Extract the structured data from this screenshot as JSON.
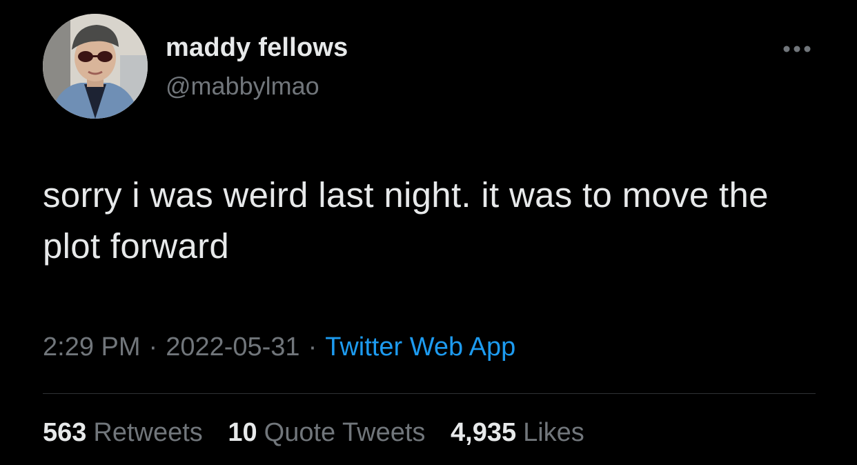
{
  "tweet": {
    "author": {
      "name": "maddy fellows",
      "handle": "@mabbylmao"
    },
    "text": "sorry i was weird last night. it was to move the plot forward",
    "time": "2:29 PM",
    "date": "2022-05-31",
    "separator": "·",
    "source": "Twitter Web App",
    "stats": {
      "retweets": {
        "count": "563",
        "label": "Retweets"
      },
      "quotes": {
        "count": "10",
        "label": "Quote Tweets"
      },
      "likes": {
        "count": "4,935",
        "label": "Likes"
      }
    }
  },
  "colors": {
    "background": "#000000",
    "primary_text": "#e7e9ea",
    "secondary_text": "#71767b",
    "link": "#1d9bf0",
    "divider": "#2f3336"
  },
  "icons": {
    "more": "more-horizontal-icon"
  }
}
